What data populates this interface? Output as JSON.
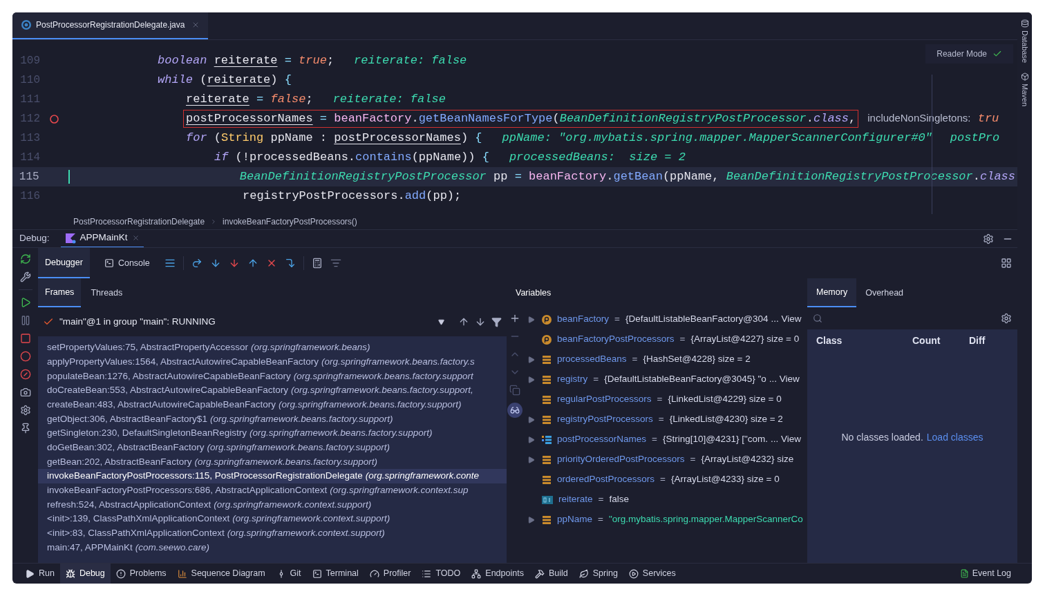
{
  "editor": {
    "tab": {
      "title": "PostProcessorRegistrationDelegate.java",
      "selected": true
    },
    "reader_mode": "Reader Mode",
    "lines": [
      {
        "number": "109",
        "breakpoint": false,
        "current": false,
        "changed": false,
        "highlighted": false,
        "code": [
          {
            "kind": "kw",
            "t": "boolean "
          },
          {
            "kind": "ul",
            "t": "reiterate"
          },
          {
            "kind": "op",
            "t": " = "
          },
          {
            "kind": "lit",
            "t": "true"
          },
          {
            "kind": "txt",
            "t": ";"
          }
        ],
        "hints": [
          {
            "kind": "value",
            "segs": [
              {
                "kind": "hint",
                "t": "reiterate: false"
              }
            ]
          }
        ]
      },
      {
        "number": "110",
        "breakpoint": false,
        "current": false,
        "changed": false,
        "highlighted": false,
        "code": [
          {
            "kind": "kw",
            "t": "while"
          },
          {
            "kind": "txt",
            "t": " ("
          },
          {
            "kind": "ul",
            "t": "reiterate"
          },
          {
            "kind": "txt",
            "t": ") "
          },
          {
            "kind": "op",
            "t": "{"
          }
        ],
        "children": [
          {
            "number": "111",
            "breakpoint": false,
            "current": false,
            "changed": false,
            "highlighted": false,
            "code": [
              {
                "kind": "ul",
                "t": "reiterate"
              },
              {
                "kind": "op",
                "t": " = "
              },
              {
                "kind": "lit",
                "t": "false"
              },
              {
                "kind": "txt",
                "t": ";"
              }
            ],
            "hints": [
              {
                "kind": "value",
                "segs": [
                  {
                    "kind": "hint",
                    "t": "reiterate: false"
                  }
                ]
              }
            ]
          },
          {
            "number": "112",
            "breakpoint": true,
            "current": false,
            "changed": false,
            "highlighted": true,
            "code": [
              {
                "kind": "ul",
                "t": "postProcessorNames"
              },
              {
                "kind": "op",
                "t": " = "
              },
              {
                "kind": "fld",
                "t": "beanFactory"
              },
              {
                "kind": "txt",
                "t": "."
              },
              {
                "kind": "call",
                "t": "getBeanNamesForType"
              },
              {
                "kind": "txt",
                "t": "("
              },
              {
                "kind": "cls",
                "t": "BeanDefinitionRegistryPostProcessor"
              },
              {
                "kind": "txt",
                "t": "."
              },
              {
                "kind": "kw",
                "t": "class"
              },
              {
                "kind": "txt",
                "t": ","
              }
            ],
            "hints": [
              {
                "kind": "param",
                "segs": [
                  {
                    "kind": "label",
                    "t": "includeNonSingletons:"
                  },
                  {
                    "kind": "lit",
                    "t": " tru"
                  }
                ]
              }
            ]
          },
          {
            "number": "113",
            "breakpoint": false,
            "current": false,
            "changed": false,
            "highlighted": false,
            "code": [
              {
                "kind": "kw",
                "t": "for"
              },
              {
                "kind": "txt",
                "t": " ("
              },
              {
                "kind": "type",
                "t": "String"
              },
              {
                "kind": "txt",
                "t": " ppName : "
              },
              {
                "kind": "ul",
                "t": "postProcessorNames"
              },
              {
                "kind": "txt",
                "t": ") "
              },
              {
                "kind": "op",
                "t": "{"
              }
            ],
            "hints": [
              {
                "kind": "value",
                "segs": [
                  {
                    "kind": "hint",
                    "t": "ppName: \"org.mybatis.spring.mapper.MapperScannerConfigurer#0\""
                  }
                ]
              },
              {
                "kind": "value",
                "segs": [
                  {
                    "kind": "hint",
                    "t": "postPro"
                  }
                ]
              }
            ],
            "children": [
              {
                "number": "114",
                "breakpoint": false,
                "current": false,
                "changed": false,
                "highlighted": false,
                "code": [
                  {
                    "kind": "kw",
                    "t": "if"
                  },
                  {
                    "kind": "txt",
                    "t": " (!processedBeans."
                  },
                  {
                    "kind": "call",
                    "t": "contains"
                  },
                  {
                    "kind": "txt",
                    "t": "(ppName)) "
                  },
                  {
                    "kind": "op",
                    "t": "{"
                  }
                ],
                "hints": [
                  {
                    "kind": "value",
                    "segs": [
                      {
                        "kind": "hint",
                        "t": "processedBeans:  size = 2"
                      }
                    ]
                  }
                ],
                "children": [
                  {
                    "number": "115",
                    "breakpoint": false,
                    "current": true,
                    "changed": true,
                    "highlighted": false,
                    "code": [
                      {
                        "kind": "cls",
                        "t": "BeanDefinitionRegistryPostProcessor"
                      },
                      {
                        "kind": "txt",
                        "t": " pp "
                      },
                      {
                        "kind": "op",
                        "t": "= "
                      },
                      {
                        "kind": "fld",
                        "t": "beanFactory"
                      },
                      {
                        "kind": "txt",
                        "t": "."
                      },
                      {
                        "kind": "call",
                        "t": "getBean"
                      },
                      {
                        "kind": "txt",
                        "t": "(ppName, "
                      },
                      {
                        "kind": "cls",
                        "t": "BeanDefinitionRegistryPostProcessor"
                      },
                      {
                        "kind": "txt",
                        "t": "."
                      },
                      {
                        "kind": "kw",
                        "t": "class"
                      }
                    ]
                  },
                  {
                    "number": "116",
                    "breakpoint": false,
                    "current": false,
                    "changed": false,
                    "highlighted": false,
                    "code": [
                      {
                        "kind": "txt",
                        "t": "registryPostProcessors."
                      },
                      {
                        "kind": "call",
                        "t": "add"
                      },
                      {
                        "kind": "txt",
                        "t": "(pp);"
                      }
                    ]
                  }
                ]
              }
            ]
          }
        ]
      }
    ]
  },
  "breadcrumbs": [
    "PostProcessorRegistrationDelegate",
    "invokeBeanFactoryPostProcessors()"
  ],
  "debug": {
    "label": "Debug:",
    "session": {
      "title": "APPMainKt",
      "selected": true
    },
    "tabs": [
      {
        "label": "Debugger",
        "selected": true,
        "kind": "plain"
      },
      {
        "label": "Console",
        "selected": false,
        "kind": "console"
      }
    ],
    "frames_tabs": [
      {
        "label": "Frames",
        "selected": true
      },
      {
        "label": "Threads",
        "selected": false
      }
    ],
    "thread": "\"main\"@1 in group \"main\": RUNNING",
    "frames": [
      {
        "location": "setPropertyValues:75, AbstractPropertyAccessor",
        "package": "(org.springframework.beans)",
        "selected": false
      },
      {
        "location": "applyPropertyValues:1564, AbstractAutowireCapableBeanFactory",
        "package": "(org.springframework.beans.factory.s",
        "selected": false
      },
      {
        "location": "populateBean:1276, AbstractAutowireCapableBeanFactory",
        "package": "(org.springframework.beans.factory.support",
        "selected": false
      },
      {
        "location": "doCreateBean:553, AbstractAutowireCapableBeanFactory",
        "package": "(org.springframework.beans.factory.support,",
        "selected": false
      },
      {
        "location": "createBean:483, AbstractAutowireCapableBeanFactory",
        "package": "(org.springframework.beans.factory.support)",
        "selected": false
      },
      {
        "location": "getObject:306, AbstractBeanFactory$1",
        "package": "(org.springframework.beans.factory.support)",
        "selected": false
      },
      {
        "location": "getSingleton:230, DefaultSingletonBeanRegistry",
        "package": "(org.springframework.beans.factory.support)",
        "selected": false
      },
      {
        "location": "doGetBean:302, AbstractBeanFactory",
        "package": "(org.springframework.beans.factory.support)",
        "selected": false
      },
      {
        "location": "getBean:202, AbstractBeanFactory",
        "package": "(org.springframework.beans.factory.support)",
        "selected": false
      },
      {
        "location": "invokeBeanFactoryPostProcessors:115, PostProcessorRegistrationDelegate",
        "package": "(org.springframework.conte",
        "selected": true
      },
      {
        "location": "invokeBeanFactoryPostProcessors:686, AbstractApplicationContext",
        "package": "(org.springframework.context.sup",
        "selected": false
      },
      {
        "location": "refresh:524, AbstractApplicationContext",
        "package": "(org.springframework.context.support)",
        "selected": false
      },
      {
        "location": "<init>:139, ClassPathXmlApplicationContext",
        "package": "(org.springframework.context.support)",
        "selected": false
      },
      {
        "location": "<init>:83, ClassPathXmlApplicationContext",
        "package": "(org.springframework.context.support)",
        "selected": false
      },
      {
        "location": "main:47, APPMainKt",
        "package": "(com.seewo.care)",
        "selected": false
      }
    ],
    "variables": {
      "title": "Variables",
      "items": [
        {
          "kind": "param",
          "expandable": true,
          "name": "beanFactory",
          "sep": "=",
          "value": "{DefaultListableBeanFactory@304",
          "is_string": false,
          "link": "... View"
        },
        {
          "kind": "param",
          "expandable": false,
          "name": "beanFactoryPostProcessors",
          "sep": "=",
          "value": "{ArrayList@4227}  size = 0",
          "is_string": false
        },
        {
          "kind": "field",
          "expandable": true,
          "name": "processedBeans",
          "sep": "=",
          "value": "{HashSet@4228}  size = 2",
          "is_string": false
        },
        {
          "kind": "field",
          "expandable": true,
          "name": "registry",
          "sep": "=",
          "value": "{DefaultListableBeanFactory@3045} \"o",
          "is_string": false,
          "link": "... View"
        },
        {
          "kind": "field",
          "expandable": false,
          "name": "regularPostProcessors",
          "sep": "=",
          "value": "{LinkedList@4229}  size = 0",
          "is_string": false
        },
        {
          "kind": "field",
          "expandable": true,
          "name": "registryPostProcessors",
          "sep": "=",
          "value": "{LinkedList@4230}  size = 2",
          "is_string": false
        },
        {
          "kind": "array",
          "expandable": true,
          "name": "postProcessorNames",
          "sep": "=",
          "value": "{String[10]@4231} [\"com.",
          "is_string": false,
          "link": "... View"
        },
        {
          "kind": "field",
          "expandable": true,
          "name": "priorityOrderedPostProcessors",
          "sep": "=",
          "value": "{ArrayList@4232}  size",
          "is_string": false
        },
        {
          "kind": "field",
          "expandable": false,
          "name": "orderedPostProcessors",
          "sep": "=",
          "value": "{ArrayList@4233}  size = 0",
          "is_string": false
        },
        {
          "kind": "bool",
          "expandable": false,
          "name": "reiterate",
          "sep": "=",
          "value": "false",
          "is_string": false
        },
        {
          "kind": "field",
          "expandable": true,
          "name": "ppName",
          "sep": "=",
          "value": "\"org.mybatis.spring.mapper.MapperScannerCo",
          "is_string": true
        }
      ]
    },
    "memory": {
      "tabs": [
        {
          "label": "Memory",
          "selected": true
        },
        {
          "label": "Overhead",
          "selected": false
        }
      ],
      "columns": [
        "Class",
        "Count",
        "Diff"
      ],
      "empty": "No classes loaded.",
      "link": "Load classes"
    }
  },
  "tool_windows": [
    {
      "label": "Run",
      "kind": "run",
      "selected": false
    },
    {
      "label": "Debug",
      "kind": "debug",
      "selected": true
    },
    {
      "label": "Problems",
      "kind": "problems",
      "selected": false
    },
    {
      "label": "Sequence Diagram",
      "kind": "sequence",
      "selected": false
    },
    {
      "label": "Git",
      "kind": "git",
      "selected": false
    },
    {
      "label": "Terminal",
      "kind": "terminal",
      "selected": false
    },
    {
      "label": "Profiler",
      "kind": "profiler",
      "selected": false
    },
    {
      "label": "TODO",
      "kind": "todo",
      "selected": false
    },
    {
      "label": "Endpoints",
      "kind": "endpoints",
      "selected": false
    },
    {
      "label": "Build",
      "kind": "build",
      "selected": false
    },
    {
      "label": "Spring",
      "kind": "spring",
      "selected": false
    },
    {
      "label": "Services",
      "kind": "services",
      "selected": false
    }
  ],
  "event_log": "Event Log",
  "side_tools": [
    "Database",
    "Maven"
  ]
}
